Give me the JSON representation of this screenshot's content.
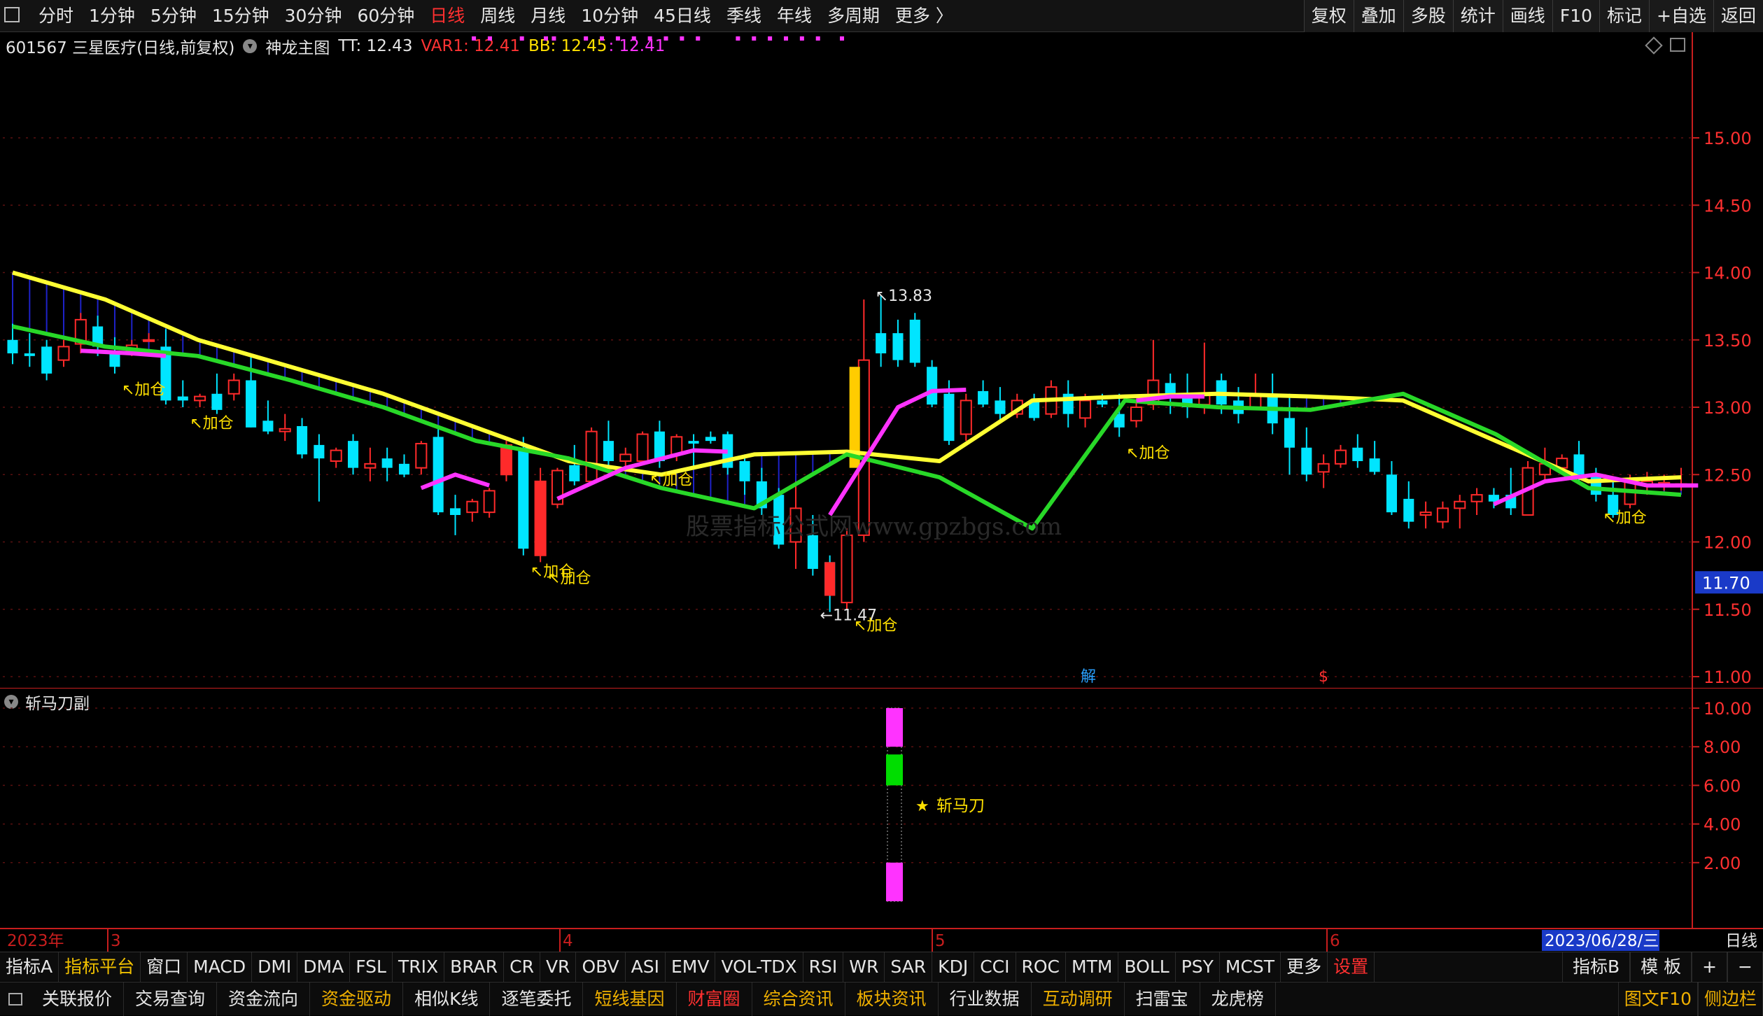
{
  "toolbar": {
    "periods": [
      "分时",
      "1分钟",
      "5分钟",
      "15分钟",
      "30分钟",
      "60分钟",
      "日线",
      "周线",
      "月线",
      "10分钟",
      "45日线",
      "季线",
      "年线",
      "多周期",
      "更多 〉"
    ],
    "active_period": "日线",
    "right_buttons": [
      "复权",
      "叠加",
      "多股",
      "统计",
      "画线",
      "F10",
      "标记",
      "+自选",
      "返回"
    ]
  },
  "info": {
    "code_name": "601567 三星医疗(日线,前复权)",
    "indicator": "神龙主图",
    "tt": "TT: 12.43",
    "var1": "VAR1: 12.41",
    "bb": "BB: 12.45",
    "bb2": ": 12.41"
  },
  "colors": {
    "up": "#ff2a2a",
    "down": "#00e5ff",
    "yellow_line": "#ffff33",
    "green_line": "#28d828",
    "magenta_line": "#ff33ff",
    "axis": "#c81e1e"
  },
  "main_axis": {
    "ticks": [
      "15.00",
      "14.50",
      "14.00",
      "13.50",
      "13.00",
      "12.50",
      "12.00",
      "11.50",
      "11.00"
    ],
    "current_price": "11.70"
  },
  "annotations": {
    "high": "13.83",
    "low": "11.47",
    "signal": "加仓",
    "watermark": "股票指标公式网www.gpzbgs.com",
    "event_jie": "解",
    "event_s": "$"
  },
  "sub": {
    "title": "斩马刀副",
    "ticks": [
      "10.00",
      "8.00",
      "6.00",
      "4.00",
      "2.00"
    ],
    "signal_label": "斩马刀"
  },
  "chart_data": [
    {
      "type": "candlestick",
      "ylim": [
        10.6,
        15.3
      ],
      "ohlc": [
        [
          13.5,
          13.62,
          13.32,
          13.4
        ],
        [
          13.4,
          13.55,
          13.3,
          13.38
        ],
        [
          13.45,
          13.5,
          13.2,
          13.25
        ],
        [
          13.35,
          13.5,
          13.3,
          13.45
        ],
        [
          13.47,
          13.7,
          13.4,
          13.65
        ],
        [
          13.6,
          13.68,
          13.38,
          13.45
        ],
        [
          13.42,
          13.52,
          13.25,
          13.3
        ],
        [
          13.42,
          13.5,
          13.38,
          13.46
        ],
        [
          13.5,
          13.55,
          13.49,
          13.5
        ],
        [
          13.45,
          13.58,
          13.02,
          13.05
        ],
        [
          13.08,
          13.2,
          13.0,
          13.05
        ],
        [
          13.05,
          13.1,
          13.0,
          13.08
        ],
        [
          13.1,
          13.25,
          12.95,
          12.98
        ],
        [
          13.1,
          13.25,
          13.05,
          13.2
        ],
        [
          13.2,
          13.4,
          12.85,
          12.85
        ],
        [
          12.9,
          13.05,
          12.8,
          12.82
        ],
        [
          12.82,
          12.95,
          12.75,
          12.84
        ],
        [
          12.86,
          12.92,
          12.62,
          12.65
        ],
        [
          12.72,
          12.8,
          12.3,
          12.62
        ],
        [
          12.6,
          12.7,
          12.55,
          12.68
        ],
        [
          12.75,
          12.8,
          12.5,
          12.55
        ],
        [
          12.55,
          12.7,
          12.45,
          12.58
        ],
        [
          12.62,
          12.7,
          12.45,
          12.55
        ],
        [
          12.58,
          12.65,
          12.48,
          12.5
        ],
        [
          12.55,
          12.75,
          12.5,
          12.73
        ],
        [
          12.78,
          12.85,
          12.2,
          12.22
        ],
        [
          12.25,
          12.35,
          12.05,
          12.2
        ],
        [
          12.22,
          12.32,
          12.15,
          12.3
        ],
        [
          12.22,
          12.4,
          12.18,
          12.38
        ],
        [
          12.5,
          12.75,
          12.45,
          12.72
        ],
        [
          12.7,
          12.78,
          11.9,
          11.95
        ],
        [
          11.9,
          12.55,
          11.85,
          12.45
        ],
        [
          12.28,
          12.55,
          12.25,
          12.53
        ],
        [
          12.57,
          12.72,
          12.42,
          12.45
        ],
        [
          12.45,
          12.85,
          12.45,
          12.82
        ],
        [
          12.75,
          12.9,
          12.55,
          12.6
        ],
        [
          12.6,
          12.7,
          12.55,
          12.65
        ],
        [
          12.6,
          12.82,
          12.58,
          12.8
        ],
        [
          12.82,
          12.9,
          12.55,
          12.6
        ],
        [
          12.65,
          12.8,
          12.6,
          12.78
        ],
        [
          12.75,
          12.8,
          12.55,
          12.73
        ],
        [
          12.78,
          12.82,
          12.73,
          12.75
        ],
        [
          12.8,
          12.82,
          12.5,
          12.55
        ],
        [
          12.6,
          12.65,
          12.35,
          12.45
        ],
        [
          12.45,
          12.55,
          12.2,
          12.25
        ],
        [
          12.35,
          12.4,
          11.95,
          11.98
        ],
        [
          12.0,
          12.45,
          11.8,
          12.25
        ],
        [
          12.05,
          12.2,
          11.75,
          11.8
        ],
        [
          11.85,
          11.9,
          11.48,
          11.6
        ],
        [
          11.55,
          12.1,
          11.5,
          12.05
        ],
        [
          12.05,
          13.8,
          12.0,
          13.35
        ],
        [
          13.55,
          13.83,
          13.3,
          13.4
        ],
        [
          13.55,
          13.65,
          13.3,
          13.35
        ],
        [
          13.65,
          13.7,
          13.3,
          13.33
        ],
        [
          13.3,
          13.35,
          13.0,
          13.02
        ],
        [
          13.1,
          13.2,
          12.72,
          12.75
        ],
        [
          12.8,
          13.1,
          12.75,
          13.05
        ],
        [
          13.12,
          13.2,
          13.0,
          13.02
        ],
        [
          13.05,
          13.15,
          12.9,
          12.95
        ],
        [
          12.95,
          13.1,
          12.92,
          13.05
        ],
        [
          13.05,
          13.1,
          12.9,
          12.92
        ],
        [
          12.95,
          13.2,
          12.92,
          13.15
        ],
        [
          13.1,
          13.2,
          12.85,
          12.95
        ],
        [
          12.92,
          13.1,
          12.85,
          13.05
        ],
        [
          13.05,
          13.1,
          13.0,
          13.02
        ],
        [
          12.95,
          13.1,
          12.78,
          12.85
        ],
        [
          12.9,
          13.05,
          12.85,
          13.0
        ],
        [
          13.02,
          13.5,
          12.98,
          13.2
        ],
        [
          13.18,
          13.25,
          12.95,
          13.1
        ],
        [
          13.1,
          13.25,
          12.92,
          13.0
        ],
        [
          13.02,
          13.48,
          12.95,
          13.1
        ],
        [
          13.2,
          13.25,
          12.95,
          13.02
        ],
        [
          13.05,
          13.15,
          12.88,
          12.95
        ],
        [
          13.0,
          13.25,
          12.98,
          13.1
        ],
        [
          13.08,
          13.25,
          12.8,
          12.88
        ],
        [
          12.92,
          13.1,
          12.5,
          12.7
        ],
        [
          12.7,
          12.85,
          12.45,
          12.5
        ],
        [
          12.52,
          12.65,
          12.4,
          12.58
        ],
        [
          12.58,
          12.72,
          12.55,
          12.68
        ],
        [
          12.7,
          12.8,
          12.55,
          12.6
        ],
        [
          12.62,
          12.75,
          12.5,
          12.52
        ],
        [
          12.5,
          12.6,
          12.2,
          12.22
        ],
        [
          12.32,
          12.45,
          12.1,
          12.15
        ],
        [
          12.2,
          12.3,
          12.1,
          12.22
        ],
        [
          12.15,
          12.3,
          12.1,
          12.25
        ],
        [
          12.25,
          12.35,
          12.1,
          12.3
        ],
        [
          12.3,
          12.4,
          12.2,
          12.35
        ],
        [
          12.35,
          12.4,
          12.25,
          12.3
        ],
        [
          12.35,
          12.55,
          12.2,
          12.25
        ],
        [
          12.2,
          12.6,
          12.2,
          12.55
        ],
        [
          12.5,
          12.7,
          12.45,
          12.58
        ],
        [
          12.55,
          12.65,
          12.5,
          12.62
        ],
        [
          12.65,
          12.75,
          12.45,
          12.5
        ],
        [
          12.5,
          12.55,
          12.3,
          12.35
        ],
        [
          12.35,
          12.45,
          12.18,
          12.2
        ],
        [
          12.28,
          12.5,
          12.25,
          12.45
        ],
        [
          12.42,
          12.52,
          12.35,
          12.45
        ],
        [
          12.42,
          12.5,
          12.38,
          12.44
        ],
        [
          12.42,
          12.55,
          12.38,
          12.43
        ]
      ],
      "yellow_line": [
        14.0,
        13.8,
        13.5,
        13.3,
        13.1,
        12.85,
        12.6,
        12.5,
        12.65,
        12.67,
        12.6,
        13.05,
        13.08,
        13.1,
        13.08,
        13.05,
        12.75,
        12.45,
        12.48
      ],
      "green_line": [
        13.6,
        13.45,
        13.38,
        13.2,
        13.0,
        12.75,
        12.62,
        12.4,
        12.25,
        12.65,
        12.48,
        12.1,
        13.05,
        13.0,
        12.98,
        13.1,
        12.8,
        12.4,
        12.35
      ],
      "magenta_line": [
        13.4,
        13.4,
        12.4,
        12.7,
        12.65,
        12.2,
        12.6,
        13.1,
        13.1,
        13.05,
        12.3,
        12.5,
        12.42
      ],
      "signals": [
        6,
        10,
        30,
        31,
        37,
        49,
        65,
        93
      ]
    },
    {
      "type": "bar",
      "title": "斩马刀副",
      "ylim": [
        0,
        10.8
      ],
      "segments": [
        {
          "from": 0,
          "to": 2,
          "color": "#ff33ff"
        },
        {
          "from": 6,
          "to": 7.6,
          "color": "#00dd00"
        },
        {
          "from": 8,
          "to": 10,
          "color": "#ff33ff"
        }
      ]
    }
  ],
  "datebar": {
    "year": "2023年",
    "months": [
      "3",
      "4",
      "5",
      "6"
    ],
    "date": "2023/06/28/三",
    "right_label": "日线"
  },
  "tabs1": {
    "items": [
      "指标A",
      "指标平台",
      "窗口",
      "MACD",
      "DMI",
      "DMA",
      "FSL",
      "TRIX",
      "BRAR",
      "CR",
      "VR",
      "OBV",
      "ASI",
      "EMV",
      "VOL-TDX",
      "RSI",
      "WR",
      "SAR",
      "KDJ",
      "CCI",
      "ROC",
      "MTM",
      "BOLL",
      "PSY",
      "MCST",
      "更多",
      "设置"
    ],
    "right": [
      "指标B",
      "模 板",
      "+",
      "−"
    ]
  },
  "tabs2": {
    "items": [
      "关联报价",
      "交易查询",
      "资金流向",
      "资金驱动",
      "相似K线",
      "逐笔委托",
      "短线基因",
      "财富圈",
      "综合资讯",
      "板块资讯",
      "行业数据",
      "互动调研",
      "扫雷宝",
      "龙虎榜"
    ],
    "right": [
      "图文F10",
      "侧边栏"
    ]
  }
}
